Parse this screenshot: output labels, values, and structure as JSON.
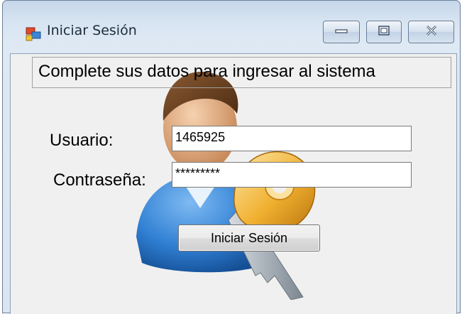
{
  "window": {
    "title": "Iniciar Sesión",
    "minimize_icon": "minimize-icon",
    "maximize_icon": "maximize-icon",
    "close_icon": "close-icon",
    "app_icon": "windows-form-icon"
  },
  "form": {
    "header": "Complete sus datos para ingresar al sistema",
    "user_label": "Usuario:",
    "user_value": "1465925",
    "password_label": "Contraseña:",
    "password_value": "*********",
    "submit_label": "Iniciar Sesión",
    "graphic_icon": "user-key-icon"
  },
  "colors": {
    "titlebar": "#c6d7ea",
    "client_background": "#f0f0f0",
    "user_shirt": "#2f7fd3",
    "key_gold": "#f0b030"
  }
}
